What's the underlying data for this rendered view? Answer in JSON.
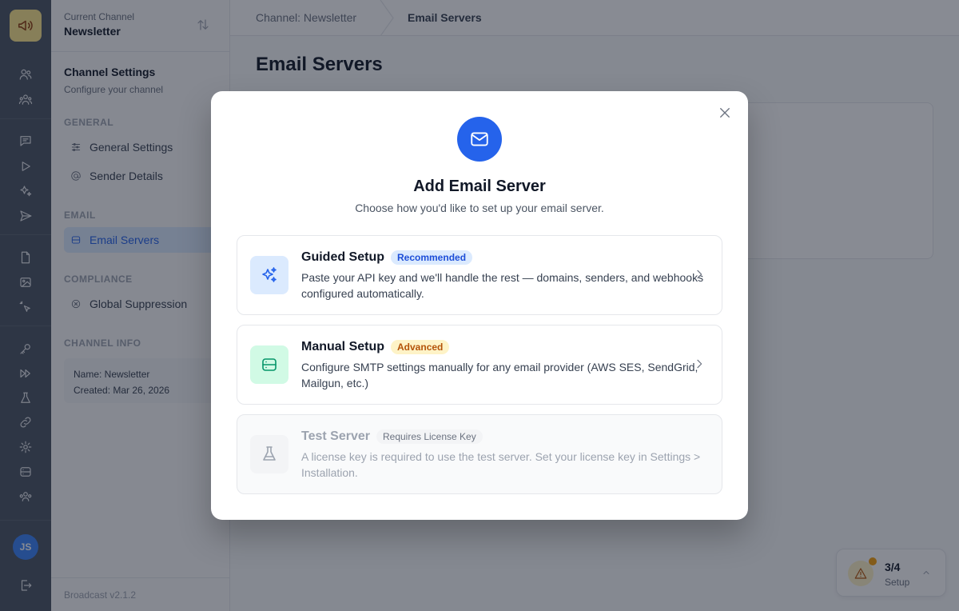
{
  "sidebar": {
    "current_channel_label": "Current Channel",
    "current_channel_name": "Newsletter",
    "title": "Channel Settings",
    "subtitle": "Configure your channel",
    "sections": {
      "general": "GENERAL",
      "email": "EMAIL",
      "compliance": "COMPLIANCE",
      "channel_info": "CHANNEL INFO"
    },
    "items": {
      "general_settings": "General Settings",
      "sender_details": "Sender Details",
      "email_servers": "Email Servers",
      "global_suppression": "Global Suppression"
    },
    "info": {
      "name": "Name: Newsletter",
      "created": "Created: Mar 26, 2026"
    },
    "version": "Broadcast v2.1.2"
  },
  "rail": {
    "avatar_initials": "JS"
  },
  "breadcrumb": {
    "parent": "Channel: Newsletter",
    "current": "Email Servers"
  },
  "page": {
    "title": "Email Servers"
  },
  "setup_widget": {
    "count": "3/4",
    "label": "Setup"
  },
  "modal": {
    "title": "Add Email Server",
    "subtitle": "Choose how you'd like to set up your email server.",
    "options": [
      {
        "name": "Guided Setup",
        "badge": "Recommended",
        "description": "Paste your API key and we'll handle the rest — domains, senders, and webhooks configured automatically.",
        "icon": "sparkles-icon"
      },
      {
        "name": "Manual Setup",
        "badge": "Advanced",
        "description": "Configure SMTP settings manually for any email provider (AWS SES, SendGrid, Mailgun, etc.)",
        "icon": "server-icon"
      },
      {
        "name": "Test Server",
        "badge": "Requires License Key",
        "description": "A license key is required to use the test server. Set your license key in Settings > Installation.",
        "icon": "flask-icon"
      }
    ]
  },
  "colors": {
    "primary": "#2563eb",
    "recommended_bg": "#dbeafe",
    "advanced_bg": "#fef3c7",
    "manual_icon_bg": "#d1fae5",
    "rail": "#4b5563"
  }
}
